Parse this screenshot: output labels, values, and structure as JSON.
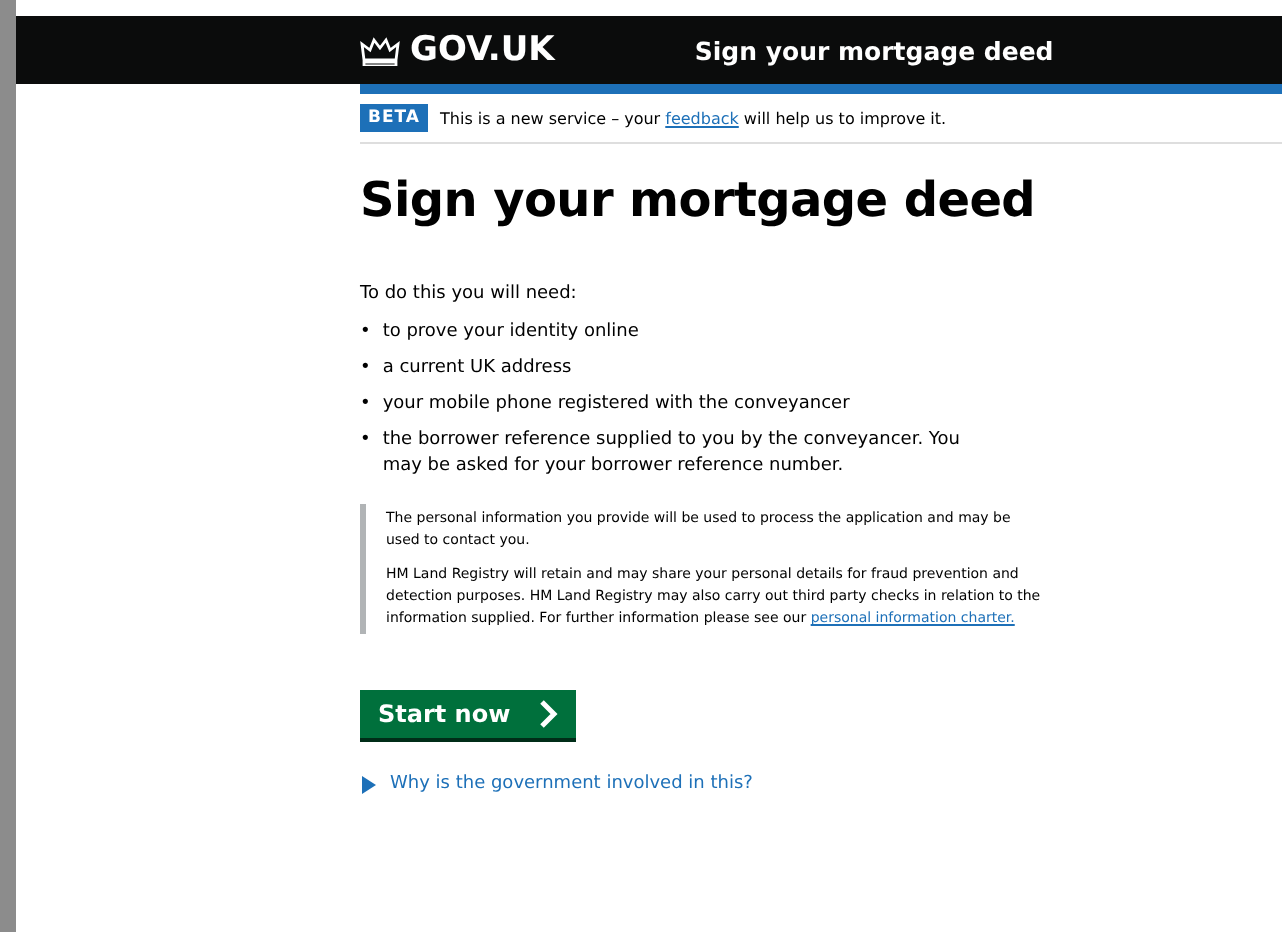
{
  "header": {
    "logo": "GOV.UK",
    "service_name": "Sign your mortgage deed"
  },
  "phase_banner": {
    "tag": "BETA",
    "before": "This is a new service – your",
    "link": "feedback",
    "after": "will help us to improve it."
  },
  "heading": "Sign your mortgage deed",
  "intro": "To do this you will need:",
  "requirements": [
    {
      "bullet": "•",
      "text": "to prove your identity online"
    },
    {
      "bullet": "•",
      "text": "a current UK address"
    },
    {
      "bullet": "•",
      "text": "your mobile phone registered with the conveyancer"
    },
    {
      "bullet": "•",
      "text": "the borrower reference supplied to you by the conveyancer. You may be asked for your borrower reference number."
    }
  ],
  "notice": {
    "paragraph_1": "The personal information you provide will be used to process the application and may be used to contact you.",
    "paragraph_2": "HM Land Registry will retain and may share your personal details for fraud prevention and detection purposes. HM Land Registry may also carry out third party checks in relation to the information supplied. For further information please see our",
    "link": "personal information charter."
  },
  "start_button": "Start now",
  "details": {
    "summary": "Why is the government involved in this?",
    "expanded": false
  }
}
